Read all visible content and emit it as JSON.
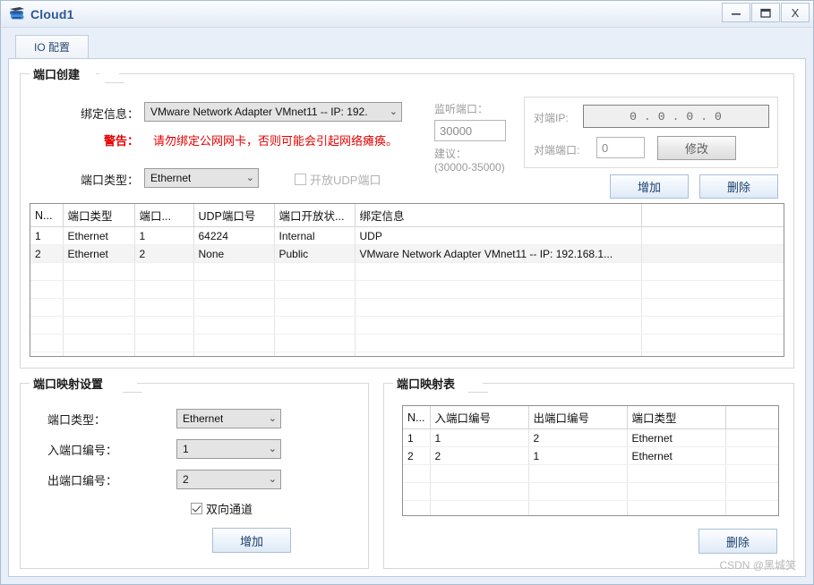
{
  "window": {
    "title": "Cloud1",
    "icon": "cloud-device-icon",
    "controls": {
      "minimize": "—",
      "maximize": "❐",
      "close": "X"
    }
  },
  "tabs": [
    {
      "label": "IO 配置",
      "active": true
    }
  ],
  "port_create": {
    "legend": "端口创建",
    "binding_label": "绑定信息：",
    "binding_value": "VMware Network Adapter VMnet11 -- IP: 192.",
    "warning_label": "警告：",
    "warning_text": "请勿绑定公网网卡，否则可能会引起网络瘫痪。",
    "port_type_label": "端口类型：",
    "port_type_value": "Ethernet",
    "udp_checkbox_label": "开放UDP端口",
    "udp_checkbox_checked": false,
    "udp_checkbox_disabled": true,
    "listen_port_label": "监听端口：",
    "listen_port_value": "30000",
    "suggest_label": "建议：",
    "suggest_range": "(30000-35000)",
    "peer_ip_label": "对端IP:",
    "peer_ip": [
      "0",
      "0",
      "0",
      "0"
    ],
    "peer_port_label": "对端端口:",
    "peer_port_value": "0",
    "modify_button": "修改",
    "add_button": "增加",
    "delete_button": "删除"
  },
  "port_table": {
    "headers": [
      "N...",
      "端口类型",
      "端口...",
      "UDP端口号",
      "端口开放状...",
      "绑定信息",
      ""
    ],
    "rows": [
      [
        "1",
        "Ethernet",
        "1",
        "64224",
        "Internal",
        "UDP",
        ""
      ],
      [
        "2",
        "Ethernet",
        "2",
        "None",
        "Public",
        "VMware Network Adapter VMnet11 -- IP: 192.168.1...",
        ""
      ]
    ],
    "empty_rows": 6
  },
  "map_settings": {
    "legend": "端口映射设置",
    "port_type_label": "端口类型：",
    "port_type_value": "Ethernet",
    "in_port_label": "入端口编号：",
    "in_port_value": "1",
    "out_port_label": "出端口编号：",
    "out_port_value": "2",
    "bidirectional_label": "双向通道",
    "bidirectional_checked": true,
    "add_button": "增加"
  },
  "map_table": {
    "legend": "端口映射表",
    "headers": [
      "N...",
      "入端口编号",
      "出端口编号",
      "端口类型",
      ""
    ],
    "rows": [
      [
        "1",
        "1",
        "2",
        "Ethernet",
        ""
      ],
      [
        "2",
        "2",
        "1",
        "Ethernet",
        ""
      ]
    ],
    "empty_rows": 4,
    "delete_button": "删除"
  },
  "watermark": "CSDN @黑城笑",
  "colors": {
    "title_blue": "#2b5797",
    "warning_red": "#e40000",
    "button_blue": "#1b3f6e",
    "window_bg": "#e9eff8"
  }
}
